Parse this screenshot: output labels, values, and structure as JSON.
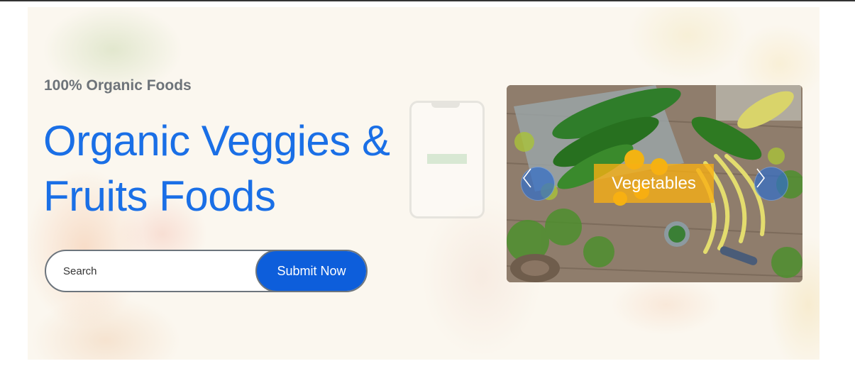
{
  "hero": {
    "subtitle": "100% Organic Foods",
    "headline_line1": "Organic Veggies &",
    "headline_line2": "Fruits Foods"
  },
  "search": {
    "placeholder": "Search",
    "value": "",
    "submit_label": "Submit Now"
  },
  "carousel": {
    "active_caption": "Vegetables",
    "prev_icon": "chevron-left-icon",
    "next_icon": "chevron-right-icon",
    "image": "vegetables-on-wooden-table"
  },
  "colors": {
    "headline": "#1a6fe6",
    "subtitle": "#6d7379",
    "button": "#0d5edb",
    "caption_bg": "#f8b012"
  }
}
